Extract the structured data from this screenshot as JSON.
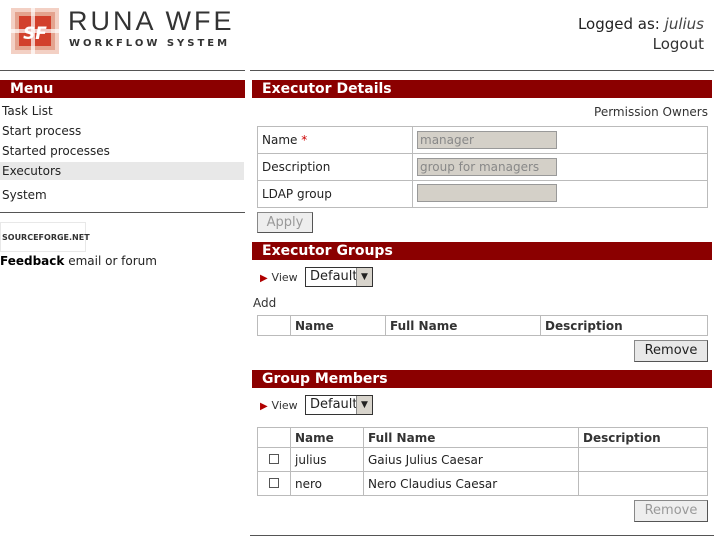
{
  "header": {
    "logo_badge": "SF",
    "app_name": "RUNA WFE",
    "app_subtitle": "WORKFLOW SYSTEM",
    "logged_label": "Logged as:",
    "username": "julius",
    "logout": "Logout"
  },
  "menu": {
    "title": "Menu",
    "items": [
      {
        "label": "Task List"
      },
      {
        "label": "Start process"
      },
      {
        "label": "Started processes"
      },
      {
        "label": "Executors"
      },
      {
        "label": "System"
      }
    ],
    "sourceforge": "SOURCEFORGE.NET",
    "feedback_label": "Feedback",
    "feedback_text": "email or forum"
  },
  "executor_details": {
    "title": "Executor Details",
    "permission_owners": "Permission Owners",
    "fields": [
      {
        "label": "Name",
        "required": "*",
        "value": "manager"
      },
      {
        "label": "Description",
        "value": "group for managers"
      },
      {
        "label": "LDAP group",
        "value": ""
      }
    ],
    "apply": "Apply"
  },
  "executor_groups": {
    "title": "Executor Groups",
    "view_label": "View",
    "view_value": "Default",
    "add_label": "Add",
    "columns": [
      "Name",
      "Full Name",
      "Description"
    ],
    "remove": "Remove"
  },
  "group_members": {
    "title": "Group Members",
    "view_label": "View",
    "view_value": "Default",
    "columns": [
      "Name",
      "Full Name",
      "Description"
    ],
    "rows": [
      {
        "name": "julius",
        "full_name": "Gaius Julius Caesar",
        "description": ""
      },
      {
        "name": "nero",
        "full_name": "Nero Claudius Caesar",
        "description": ""
      }
    ],
    "remove": "Remove"
  },
  "colors": {
    "section_bar": "#8b0000",
    "view_triangle": "#b00000"
  }
}
